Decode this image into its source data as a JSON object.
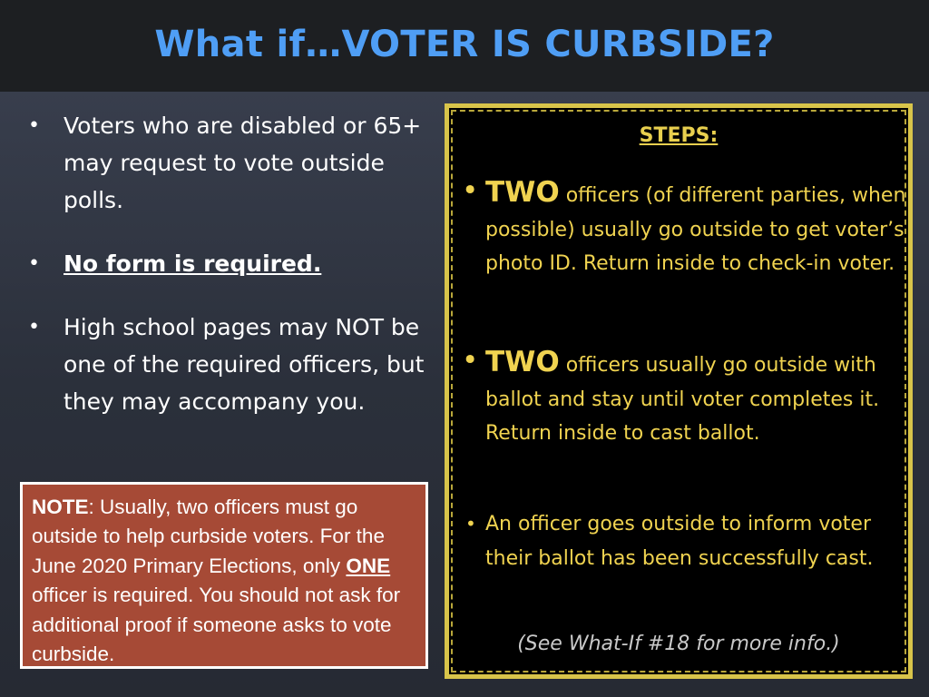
{
  "title": "What if…VOTER IS CURBSIDE?",
  "left_bullets": [
    {
      "text": "Voters who are disabled or 65+ may request to vote outside polls."
    },
    {
      "text": "No form is required."
    },
    {
      "text": "High school pages may NOT be one of the required officers, but they may accompany you."
    }
  ],
  "note": {
    "label": "NOTE",
    "part1": ": Usually, two officers must go outside to help curbside voters. For the June 2020 Primary Elections, only ",
    "emphasis": "ONE",
    "part2": " officer is required. You should not ask for additional proof if someone asks to vote curbside."
  },
  "steps": {
    "title": "STEPS:",
    "items": [
      {
        "lead": "TWO",
        "text": " officers (of different parties, when possible) usually go outside to get voter’s photo ID.  Return inside to check-in voter."
      },
      {
        "lead": "TWO",
        "text": " officers usually go outside with ballot and stay until voter completes it. Return inside to cast ballot."
      },
      {
        "lead": "",
        "text": "An officer goes outside to inform voter their ballot has been successfully cast."
      }
    ],
    "footer": "(See What-If #18 for more info.)"
  },
  "colors": {
    "title": "#4f9ef5",
    "title_bar": "#1d1f22",
    "steps_text": "#f0d350",
    "note_background": "#a64a36"
  }
}
